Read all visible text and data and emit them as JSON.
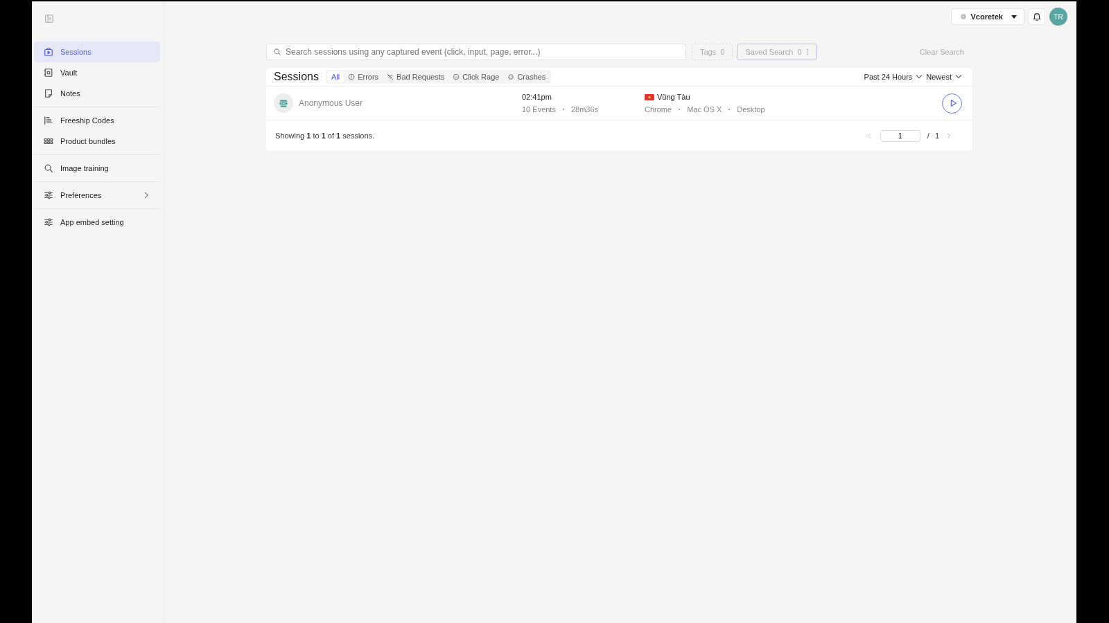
{
  "sidebar": {
    "groups": [
      {
        "items": [
          {
            "label": "Sessions",
            "selected": true
          },
          {
            "label": "Vault",
            "selected": false
          },
          {
            "label": "Notes",
            "selected": false
          }
        ]
      },
      {
        "items": [
          {
            "label": "Freeship Codes",
            "selected": false
          },
          {
            "label": "Product bundles",
            "selected": false
          }
        ]
      },
      {
        "items": [
          {
            "label": "Image training",
            "selected": false
          }
        ]
      },
      {
        "items": [
          {
            "label": "Preferences",
            "selected": false,
            "expandable": true
          }
        ]
      },
      {
        "items": [
          {
            "label": "App embed setting",
            "selected": false
          }
        ]
      }
    ]
  },
  "topbar": {
    "project": "Vcoretek",
    "avatar": "TR"
  },
  "search": {
    "placeholder": "Search sessions using any captured event (click, input, page, error...)",
    "tags": {
      "label": "Tags",
      "count": "0"
    },
    "saved": {
      "label": "Saved Search",
      "count": "0"
    },
    "clear": "Clear Search"
  },
  "sessions": {
    "title": "Sessions",
    "tabs": [
      {
        "label": "All",
        "selected": true
      },
      {
        "label": "Errors",
        "selected": false
      },
      {
        "label": "Bad Requests",
        "selected": false
      },
      {
        "label": "Click Rage",
        "selected": false
      },
      {
        "label": "Crashes",
        "selected": false
      }
    ],
    "period": "Past 24 Hours",
    "sort": "Newest",
    "rows": [
      {
        "user": "Anonymous User",
        "time": "02:41pm",
        "events": "10 Events",
        "duration": "28m36s",
        "city": "Vũng Tàu",
        "browser": "Chrome",
        "os": "Mac OS X",
        "device": "Desktop"
      }
    ],
    "summary": "Showing **1** to **1** of **1** sessions.",
    "pagination": {
      "page": "1",
      "separator": "/",
      "total": "1"
    }
  }
}
